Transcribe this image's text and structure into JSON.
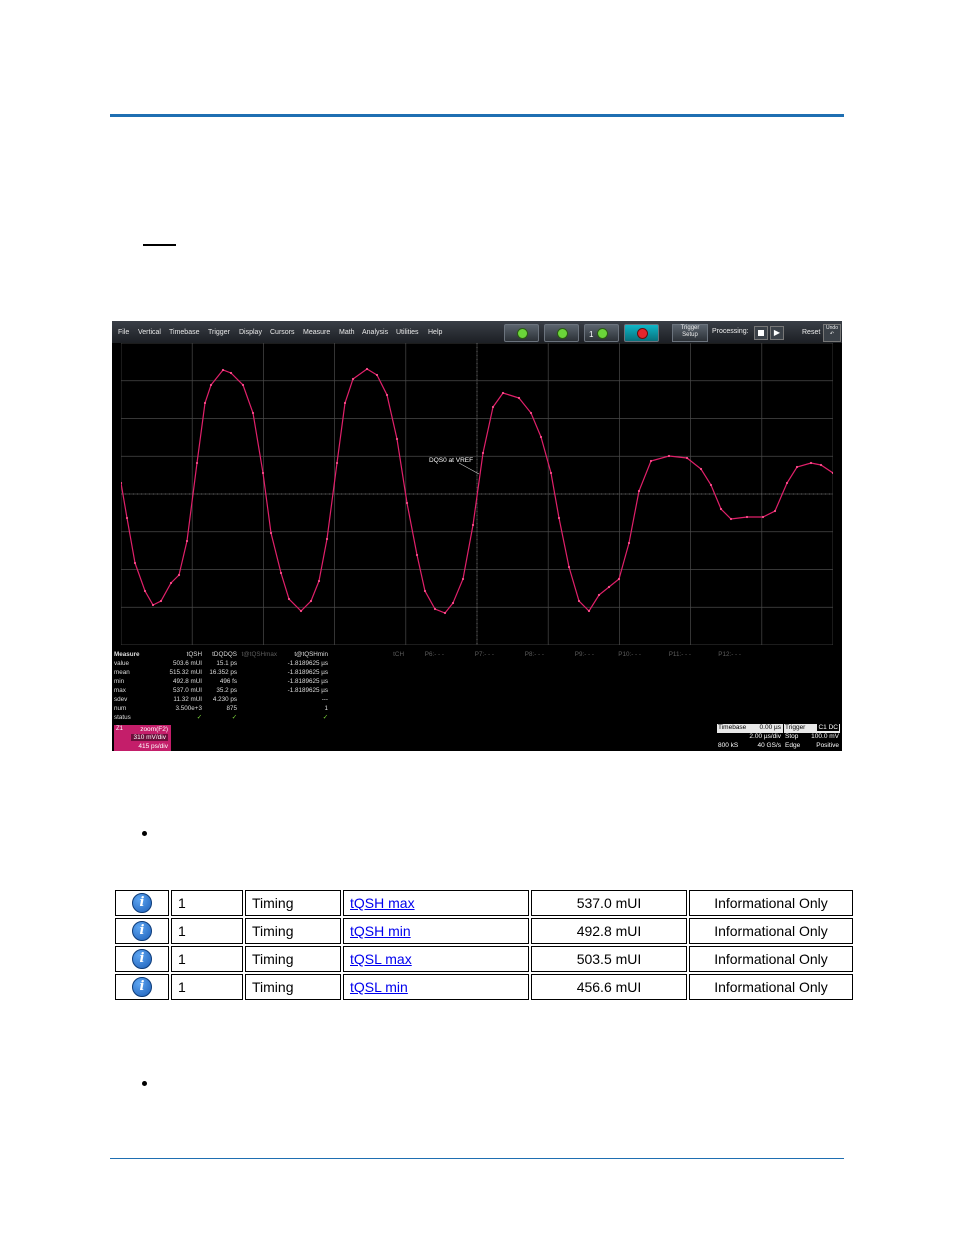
{
  "scope": {
    "menu": [
      "File",
      "Vertical",
      "Timebase",
      "Trigger",
      "Display",
      "Cursors",
      "Measure",
      "Math",
      "Analysis",
      "Utilities",
      "Help"
    ],
    "toolbar": {
      "trigger_setup_line1": "Trigger",
      "trigger_setup_line2": "Setup",
      "processing": "Processing:",
      "reset": "Reset",
      "undo_line1": "Undo",
      "undo_line2": "↶",
      "play": "▶",
      "mem_button_num": "1"
    },
    "waveform": {
      "annotation": "DQS0 at VREF",
      "channel_marker": "Z1",
      "color": "#e0206a"
    },
    "measure_table": {
      "header_label": "Measure",
      "columns": [
        "tQSH",
        "tDQDQS",
        "t@tQSHmax",
        "t@tQSHmin",
        "tCH",
        "P6:- - -",
        "P7:- - -",
        "P8:- - -",
        "P9:- - -",
        "P10:- - -",
        "P11:- - -",
        "P12:- - -"
      ],
      "rows": [
        {
          "label": "value",
          "cells": [
            "503.6 mUI",
            "15.1 ps",
            "",
            "-1.8189625 µs"
          ]
        },
        {
          "label": "mean",
          "cells": [
            "515.32 mUI",
            "16.352 ps",
            "",
            "-1.8189625 µs"
          ]
        },
        {
          "label": "min",
          "cells": [
            "492.8 mUI",
            "496 fs",
            "",
            "-1.8189625 µs"
          ]
        },
        {
          "label": "max",
          "cells": [
            "537.0 mUI",
            "35.2 ps",
            "",
            "-1.8189625 µs"
          ]
        },
        {
          "label": "sdev",
          "cells": [
            "11.32 mUI",
            "4.230 ps",
            "",
            "---"
          ]
        },
        {
          "label": "num",
          "cells": [
            "3.500e+3",
            "875",
            "",
            "1"
          ]
        },
        {
          "label": "status",
          "cells": [
            "✓",
            "✓",
            "",
            "✓"
          ]
        }
      ]
    },
    "zoom_badge": {
      "tag": "Z1",
      "title": "zoom(F2)",
      "vdiv": "310 mV/div",
      "hdiv": "415 ps/div"
    },
    "timebase": {
      "label": "Timebase",
      "value": "0.00 µs",
      "tdiv": "2.00 µs/div",
      "samples": "800 kS",
      "rate": "40 GS/s"
    },
    "trigger": {
      "label": "Trigger",
      "tag": "C1 DC",
      "mode": "Stop",
      "level": "100.0 mV",
      "type": "Edge",
      "slope": "Positive"
    }
  },
  "results_table": {
    "rows": [
      {
        "icon": "info-icon",
        "num": "1",
        "type": "Timing",
        "name": "tQSH max",
        "value": "537.0 mUI",
        "result": "Informational Only"
      },
      {
        "icon": "info-icon",
        "num": "1",
        "type": "Timing",
        "name": "tQSH min",
        "value": "492.8 mUI",
        "result": "Informational Only"
      },
      {
        "icon": "info-icon",
        "num": "1",
        "type": "Timing",
        "name": "tQSL max",
        "value": "503.5 mUI",
        "result": "Informational Only"
      },
      {
        "icon": "info-icon",
        "num": "1",
        "type": "Timing",
        "name": "tQSL min",
        "value": "456.6 mUI",
        "result": "Informational Only"
      }
    ]
  },
  "colors": {
    "rule": "#1f6fb2",
    "trace": "#e0206a",
    "link": "#0000ee"
  }
}
